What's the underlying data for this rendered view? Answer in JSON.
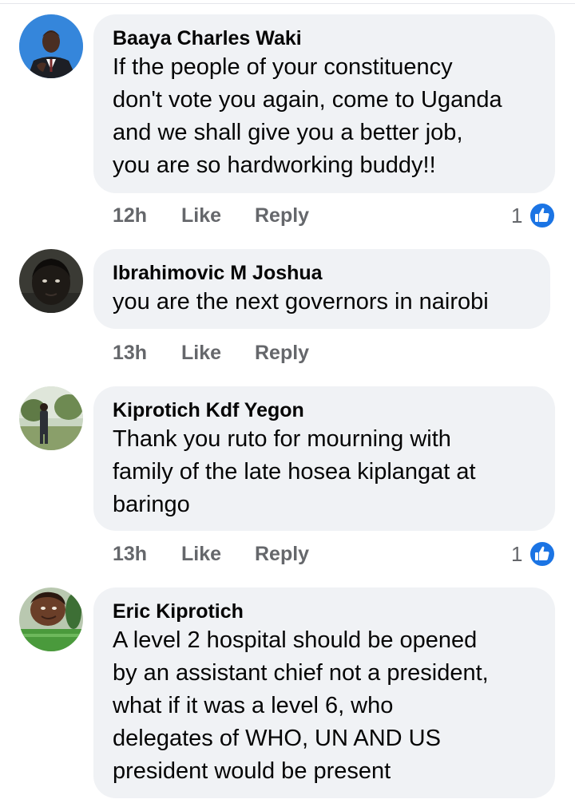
{
  "comments": [
    {
      "author": "Baaya Charles Waki",
      "text": "If the people of your constituency\ndon't vote you again, come to Uganda\nand we shall give you a better job,\nyou are so hardworking buddy!!",
      "time": "12h",
      "like_label": "Like",
      "reply_label": "Reply",
      "reaction_count": "1",
      "reaction_icon": "like-thumbs-up-icon"
    },
    {
      "author": "Ibrahimovic M Joshua",
      "text": "you are the next governors in nairobi",
      "time": "13h",
      "like_label": "Like",
      "reply_label": "Reply"
    },
    {
      "author": "Kiprotich Kdf Yegon",
      "text": "Thank you ruto for mourning with\nfamily of the late hosea kiplangat at\nbaringo",
      "time": "13h",
      "like_label": "Like",
      "reply_label": "Reply",
      "reaction_count": "1",
      "reaction_icon": "like-thumbs-up-icon"
    },
    {
      "author": "Eric Kiprotich",
      "text": "A level 2 hospital should be opened\nby an assistant chief not a president,\nwhat if it was a level 6, who\ndelegates of WHO, UN AND US\npresident would be present"
    }
  ],
  "colors": {
    "bubble_bg": "#f0f2f5",
    "text": "#050505",
    "meta": "#65676b",
    "like_blue": "#1b74e4"
  }
}
